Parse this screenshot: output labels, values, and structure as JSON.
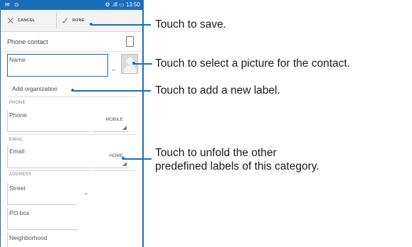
{
  "status_bar": {
    "left_icons": "✉ ⊙",
    "right_icons": "⚙ .ıll ▭",
    "time": "13:50"
  },
  "action_bar": {
    "cancel_label": "CANCEL",
    "done_label": "DONE"
  },
  "account": {
    "label": "Phone contact"
  },
  "name_field": {
    "placeholder": "Name"
  },
  "add_organization": "Add organization",
  "phone_section": {
    "title": "PHONE",
    "placeholder": "Phone",
    "type": "MOBILE"
  },
  "email_section": {
    "title": "EMAIL",
    "placeholder": "Email",
    "type": "HOME"
  },
  "address_section": {
    "title": "ADDRESS",
    "street": "Street",
    "po_box": "PO box",
    "neighborhood": "Neighborhood"
  },
  "callouts": {
    "save": "Touch to save.",
    "picture": "Touch to select a picture for the contact.",
    "label": "Touch to add a new label.",
    "unfold_line1": "Touch to unfold the other",
    "unfold_line2": "predefined labels of this category."
  },
  "colors": {
    "accent": "#1b6fb5",
    "status_bar": "#1a6db8"
  },
  "icons": [
    "cancel-icon",
    "done-icon",
    "device-icon",
    "avatar-icon",
    "chevron-down-icon"
  ]
}
